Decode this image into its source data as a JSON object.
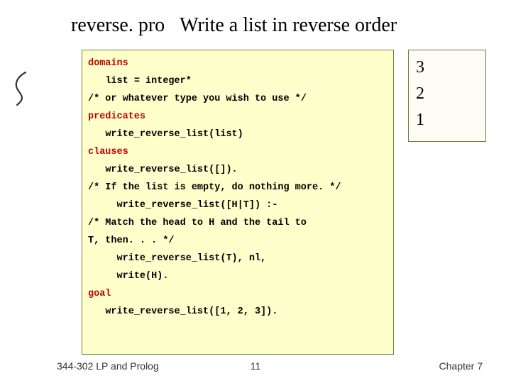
{
  "title": {
    "filename": "reverse. pro",
    "heading": "Write a list in reverse order"
  },
  "code": {
    "k_domains": "domains",
    "l1": "list = integer*",
    "l2": "/* or whatever type you wish to use */",
    "k_predicates": "predicates",
    "l3": "write_reverse_list(list)",
    "k_clauses": "clauses",
    "l4": "write_reverse_list([]).",
    "l5": "/* If the list is empty, do nothing more. */",
    "l6": "write_reverse_list([H|T]) :-",
    "l7": "/* Match the head to H and the tail to",
    "l8": "T, then. . . */",
    "l9": "write_reverse_list(T), nl,",
    "l10": "write(H).",
    "k_goal": "goal",
    "l11": "write_reverse_list([1, 2, 3])."
  },
  "sidebox": {
    "v1": "3",
    "v2": "2",
    "v3": "1"
  },
  "footer": {
    "left": "344-302 LP and Prolog",
    "center": "11",
    "right": "Chapter 7"
  }
}
